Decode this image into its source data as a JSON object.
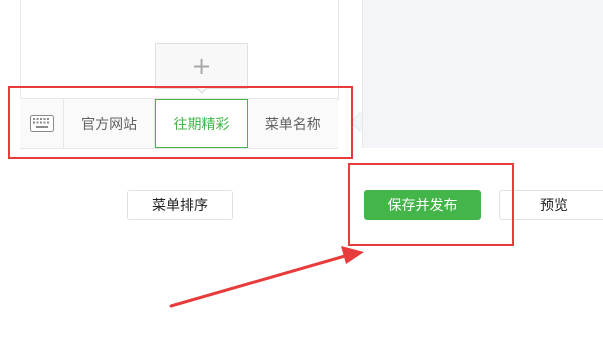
{
  "colors": {
    "accent_green": "#44b549",
    "annotation_red": "#e83b3b",
    "border": "#e7e7eb",
    "panel_bg": "#f4f5f9"
  },
  "submenu": {
    "add_icon": "+",
    "add_icon_name": "plus-icon"
  },
  "menu_bar": {
    "keyboard_icon": "keyboard-icon",
    "items": [
      {
        "label": "官方网站",
        "active": false
      },
      {
        "label": "往期精彩",
        "active": true
      },
      {
        "label": "菜单名称",
        "active": false
      }
    ]
  },
  "actions": {
    "sort_label": "菜单排序",
    "publish_label": "保存并发布",
    "preview_label": "预览"
  },
  "annotations": {
    "arrow_icon": "red-arrow-icon"
  }
}
